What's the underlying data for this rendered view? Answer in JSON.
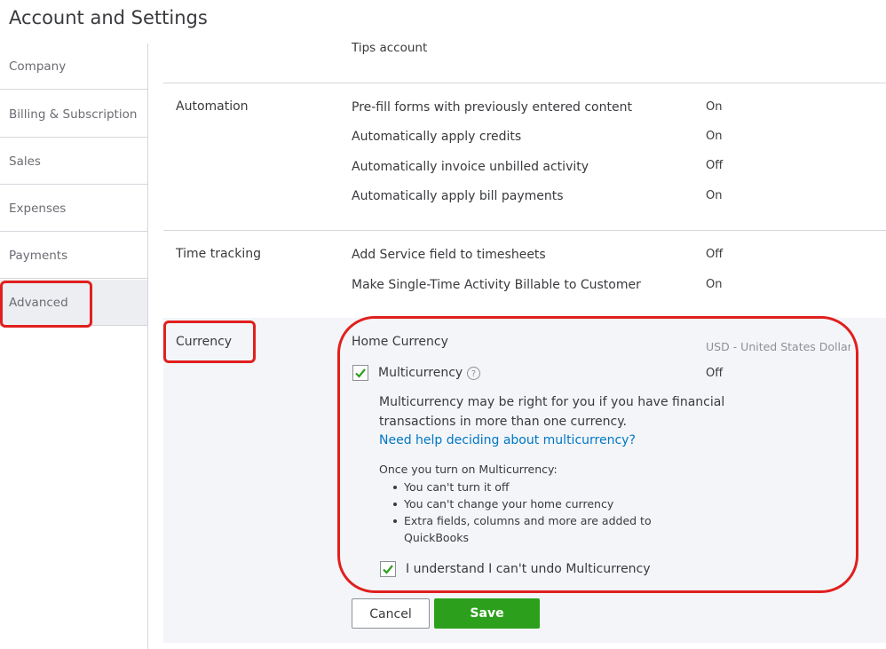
{
  "page": {
    "title": "Account and Settings"
  },
  "sidebar": {
    "items": [
      {
        "label": "Company"
      },
      {
        "label": "Billing & Subscription"
      },
      {
        "label": "Sales"
      },
      {
        "label": "Expenses"
      },
      {
        "label": "Payments"
      },
      {
        "label": "Advanced",
        "active": true
      }
    ]
  },
  "tips": {
    "text": "Tips account"
  },
  "automation": {
    "label": "Automation",
    "rows": [
      {
        "text": "Pre-fill forms with previously entered content",
        "value": "On"
      },
      {
        "text": "Automatically apply credits",
        "value": "On"
      },
      {
        "text": "Automatically invoice unbilled activity",
        "value": "Off"
      },
      {
        "text": "Automatically apply bill payments",
        "value": "On"
      }
    ]
  },
  "time_tracking": {
    "label": "Time tracking",
    "rows": [
      {
        "text": "Add Service field to timesheets",
        "value": "Off"
      },
      {
        "text": "Make Single-Time Activity Billable to Customer",
        "value": "On"
      }
    ]
  },
  "currency": {
    "label": "Currency",
    "home_currency_label": "Home Currency",
    "home_currency_value": "USD - United States Dollar",
    "multicurrency_label": "Multicurrency",
    "multicurrency_value": "Off",
    "info_glyph": "?",
    "description_line1": "Multicurrency may be right for you if you have financial",
    "description_line2": "transactions in more than one currency.",
    "help_link": "Need help deciding about multicurrency?",
    "once_label": "Once you turn on Multicurrency:",
    "bullets": [
      "You can't turn it off",
      "You can't change your home currency",
      "Extra fields, columns and more are added to QuickBooks"
    ],
    "understand_label": "I understand I can't undo Multicurrency"
  },
  "buttons": {
    "cancel": "Cancel",
    "save": "Save"
  },
  "colors": {
    "accent_green": "#2ca01c",
    "link_blue": "#0077c5",
    "highlight_red": "#e0201f"
  }
}
